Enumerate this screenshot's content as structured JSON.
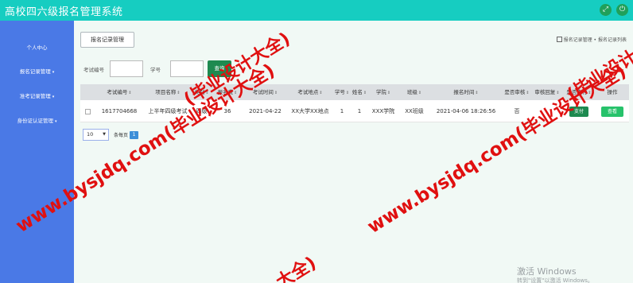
{
  "header": {
    "title": "高校四六级报名管理系统"
  },
  "sidebar": {
    "items": [
      {
        "label": "个人中心",
        "caret": ""
      },
      {
        "label": "报名记录管理",
        "caret": "▾"
      },
      {
        "label": "准考记录管理",
        "caret": "▾"
      },
      {
        "label": "身份证认证管理",
        "caret": "▾"
      }
    ]
  },
  "main": {
    "tab_label": "报名记录管理",
    "breadcrumb": {
      "home_icon": "home-icon",
      "level1": "报名记录管理",
      "separator": "•",
      "level2": "报名记录列表"
    },
    "search": {
      "exam_no_label": "考试编号",
      "student_no_label": "学号",
      "button_label": "查询"
    },
    "table": {
      "columns": [
        "",
        "考试编号",
        "项目名称",
        "类别",
        "报名费",
        "考试时间",
        "考试地点",
        "学号",
        "姓名",
        "学院",
        "班级",
        "报名时间",
        "是否审核",
        "审核回复",
        "是否支付",
        "操作"
      ],
      "sort_glyph": "⇕",
      "rows": [
        {
          "exam_no": "1617704668",
          "project": "上半年四级考试",
          "category": "四级",
          "fee": "36",
          "exam_time": "2021-04-22",
          "location": "XX大学XX地点",
          "student_no": "1",
          "name": "1",
          "college": "XXX学院",
          "class": "XX班级",
          "signup_time": "2021-04-06 18:26:56",
          "audited": "否",
          "reply": "",
          "pay_label": "支付",
          "view_label": "查看"
        }
      ]
    },
    "pagination": {
      "page_size": "10",
      "per_page_text": "条每页",
      "current_page": "1"
    }
  },
  "watermarks": [
    {
      "text": "(毕业设计大全)"
    },
    {
      "text": "www.bysjdq.com(毕业设计大全)"
    },
    {
      "text": "www.bysjdq.com(毕业设计大全)"
    },
    {
      "text": "(毕业设计"
    },
    {
      "text": "大全)"
    }
  ],
  "system_overlay": {
    "activation_title": "激活 Windows",
    "activation_subtitle": "转到\"设置\"以激活 Windows。"
  },
  "colors": {
    "topbar": "#16cdc1",
    "sidebar": "#4a79e6",
    "primary_button": "#1e8a50",
    "view_button": "#27c26b",
    "watermark": "#e01010"
  }
}
